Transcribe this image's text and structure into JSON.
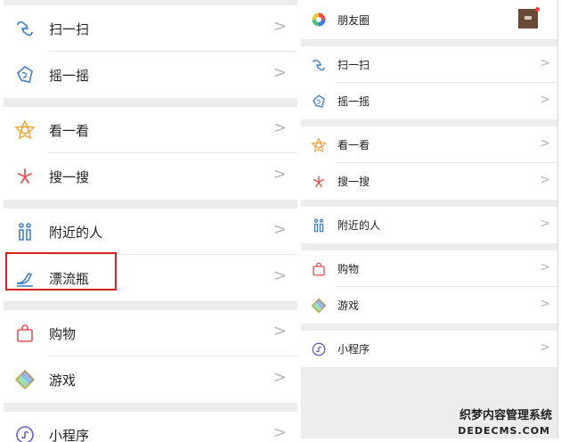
{
  "left_panel": {
    "items": [
      {
        "label": "扫一扫",
        "icon": "scan-icon"
      },
      {
        "label": "摇一摇",
        "icon": "shake-icon"
      },
      {
        "label": "看一看",
        "icon": "top-stories-icon"
      },
      {
        "label": "搜一搜",
        "icon": "search-icon"
      },
      {
        "label": "附近的人",
        "icon": "people-nearby-icon"
      },
      {
        "label": "漂流瓶",
        "icon": "drift-bottle-icon"
      },
      {
        "label": "购物",
        "icon": "shopping-bag-icon"
      },
      {
        "label": "游戏",
        "icon": "games-icon"
      },
      {
        "label": "小程序",
        "icon": "mini-programs-icon"
      }
    ]
  },
  "right_panel": {
    "items": [
      {
        "label": "朋友圈",
        "icon": "moments-icon"
      },
      {
        "label": "扫一扫",
        "icon": "scan-icon"
      },
      {
        "label": "摇一摇",
        "icon": "shake-icon"
      },
      {
        "label": "看一看",
        "icon": "top-stories-icon"
      },
      {
        "label": "搜一搜",
        "icon": "search-icon"
      },
      {
        "label": "附近的人",
        "icon": "people-nearby-icon"
      },
      {
        "label": "购物",
        "icon": "shopping-bag-icon"
      },
      {
        "label": "游戏",
        "icon": "games-icon"
      },
      {
        "label": "小程序",
        "icon": "mini-programs-icon"
      }
    ]
  },
  "chevron": ">",
  "watermark": {
    "line1": "织梦内容管理系统",
    "line2": "DEDECMS.COM"
  },
  "colors": {
    "highlight": "#e02020",
    "icon_blue": "#3b7fd6",
    "icon_orange": "#f0a030",
    "icon_red": "#e85050"
  }
}
